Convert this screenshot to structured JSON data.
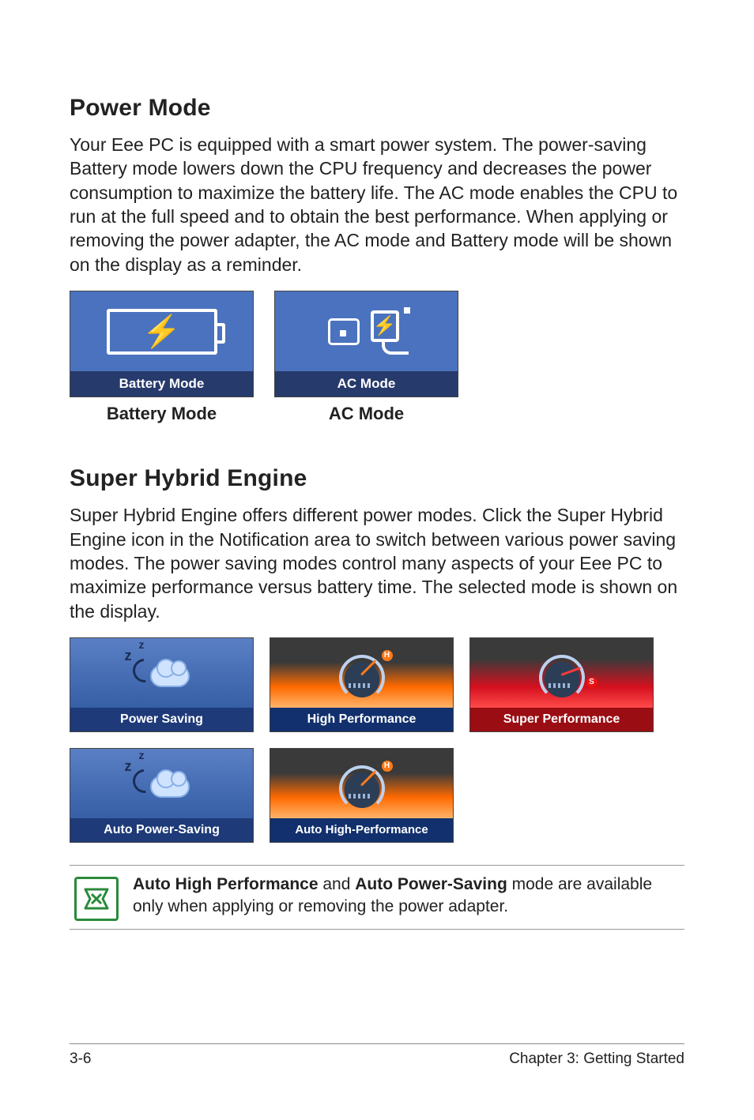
{
  "section1": {
    "heading": "Power Mode",
    "paragraph": "Your Eee PC is equipped with a smart power system. The power-saving Battery mode lowers down the CPU frequency and decreases the power consumption to maximize the battery life. The AC mode enables the CPU to run at the full speed and to obtain the best performance. When applying or removing the power adapter, the AC mode and Battery mode will be shown on the display as a reminder.",
    "cards": [
      {
        "strip": "Battery Mode",
        "caption": "Battery Mode"
      },
      {
        "strip": "AC Mode",
        "caption": "AC Mode"
      }
    ]
  },
  "section2": {
    "heading": "Super Hybrid Engine",
    "paragraph": "Super Hybrid Engine offers different power modes. Click the Super Hybrid Engine icon in the Notification area to switch between various power saving modes. The power saving modes control many aspects of your Eee PC to maximize performance versus battery time. The selected mode is shown on the display.",
    "cards": [
      {
        "label": "Power Saving"
      },
      {
        "label": "High Performance"
      },
      {
        "label": "Super Performance"
      },
      {
        "label": "Auto Power-Saving"
      },
      {
        "label": "Auto High-Performance"
      }
    ]
  },
  "note": {
    "b1": "Auto High Performance",
    "mid": " and ",
    "b2": "Auto Power-Saving",
    "tail": " mode are available only when applying or removing the power adapter."
  },
  "footer": {
    "left": "3-6",
    "right": "Chapter 3: Getting Started"
  }
}
